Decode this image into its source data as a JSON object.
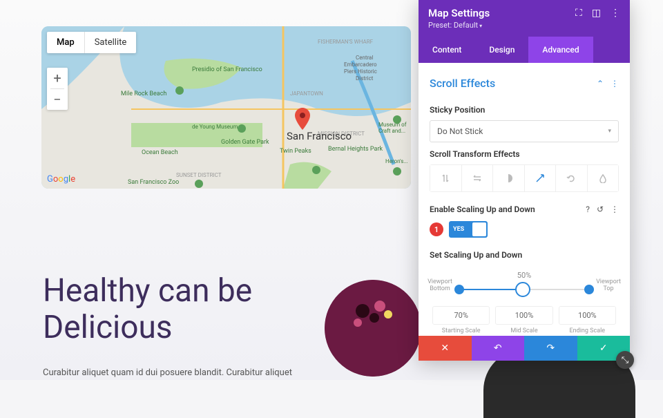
{
  "map": {
    "type_map": "Map",
    "type_sat": "Satellite",
    "city_label": "San Francisco",
    "attribution": "Google",
    "labels": {
      "presidio": "Presidio of San Francisco",
      "mile_rock": "Mile Rock Beach",
      "ocean_beach": "Ocean Beach",
      "gg_park": "Golden Gate Park",
      "deyoung": "de Young Museum",
      "sunset": "SUNSET DISTRICT",
      "zoo": "San Francisco Zoo",
      "japantown": "JAPANTOWN",
      "mission": "MISSION DISTRICT",
      "twin": "Twin Peaks",
      "bernal": "Bernal Heights Park",
      "wharf": "FISHERMAN'S WHARF",
      "embarc": "Central Embarcadero Piers Historic District",
      "museum": "Museum of Craft and...",
      "heron": "Heron's..."
    }
  },
  "hero": {
    "line1": "Healthy can be",
    "line2": "Delicious",
    "sub": "Curabitur aliquet quam id dui posuere blandit. Curabitur aliquet"
  },
  "panel": {
    "title": "Map Settings",
    "preset": "Preset: Default",
    "tabs": {
      "content": "Content",
      "design": "Design",
      "advanced": "Advanced"
    },
    "section": "Scroll Effects",
    "sticky_label": "Sticky Position",
    "sticky_value": "Do Not Stick",
    "transform_label": "Scroll Transform Effects",
    "enable_label": "Enable Scaling Up and Down",
    "toggle_text": "YES",
    "badge": "1",
    "set_label": "Set Scaling Up and Down",
    "center_pct": "50%",
    "viewport_bottom": "Viewport Bottom",
    "viewport_top": "Viewport Top",
    "scales": {
      "start_v": "70%",
      "start_l": "Starting Scale",
      "mid_v": "100%",
      "mid_l": "Mid Scale",
      "end_v": "100%",
      "end_l": "Ending Scale"
    }
  }
}
